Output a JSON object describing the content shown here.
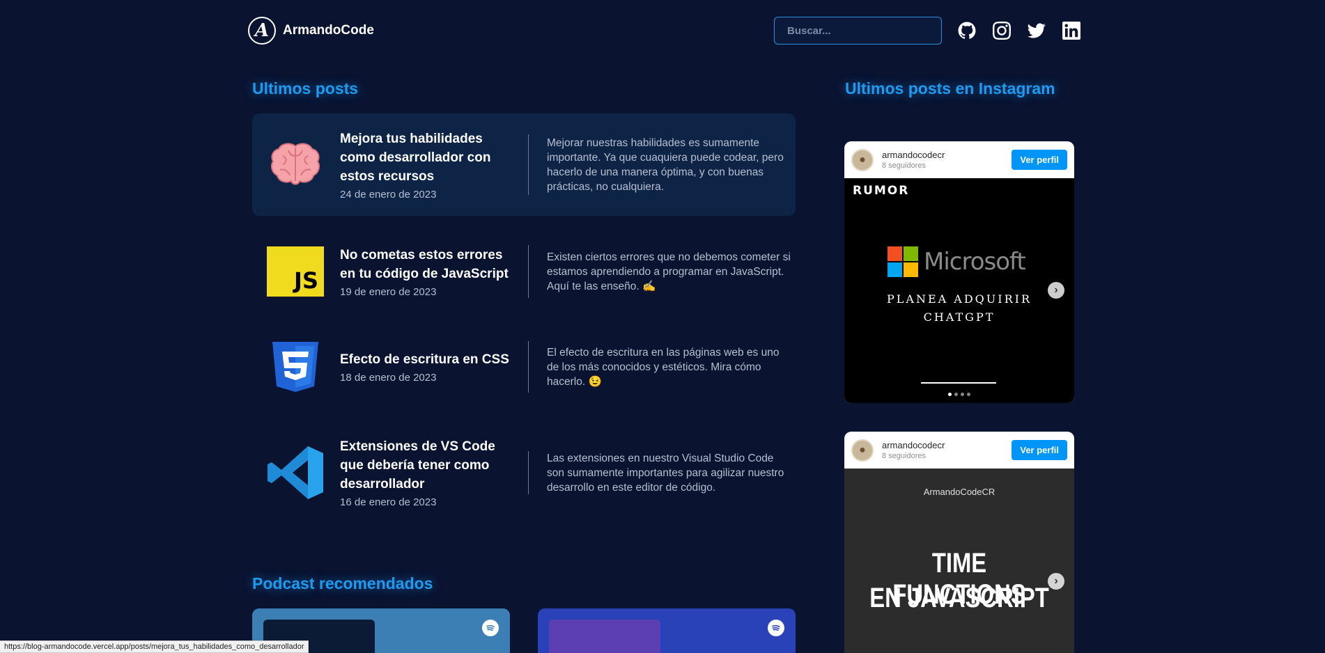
{
  "header": {
    "brand_initial": "A",
    "brand_name": "ArmandoCode",
    "search_placeholder": "Buscar...",
    "social_icons": [
      "github-icon",
      "instagram-icon",
      "twitter-icon",
      "linkedin-icon"
    ]
  },
  "sections": {
    "latest_posts": "Ultimos posts",
    "instagram": "Ultimos posts en Instagram",
    "podcasts": "Podcast recomendados"
  },
  "posts": [
    {
      "icon": "brain-icon",
      "title": "Mejora tus habilidades como desarrollador con estos recursos",
      "date": "24 de enero de 2023",
      "description": "Mejorar nuestras habilidades es sumamente importante. Ya que cuaquiera puede codear, pero hacerlo de una manera óptima, y con buenas prácticas, no cualquiera."
    },
    {
      "icon": "javascript-icon",
      "icon_text": "JS",
      "title": "No cometas estos errores en tu código de JavaScript",
      "date": "19 de enero de 2023",
      "description": "Existen ciertos errores que no debemos cometer si estamos aprendiendo a programar en JavaScript. Aquí te las enseño. ✍️"
    },
    {
      "icon": "css3-icon",
      "title": "Efecto de escritura en CSS",
      "date": "18 de enero de 2023",
      "description": "El efecto de escritura en las páginas web es uno de los más conocidos y estéticos. Mira cómo hacerlo. 😉"
    },
    {
      "icon": "vscode-icon",
      "title": "Extensiones de VS Code que debería tener como desarrollador",
      "date": "16 de enero de 2023",
      "description": "Las extensiones en nuestro Visual Studio Code son sumamente importantes para agilizar nuestro desarrollo en este editor de código."
    }
  ],
  "instagram_posts": [
    {
      "username": "armandocodecr",
      "followers": "8 seguidores",
      "button": "Ver perfil",
      "overlay_tag": "RUMOR",
      "brand": "Microsoft",
      "headline_line1": "PLANEA ADQUIRIR",
      "headline_line2": "CHATGPT"
    },
    {
      "username": "armandocodecr",
      "followers": "8 seguidores",
      "button": "Ver perfil",
      "caption_top": "ArmandoCodeCR",
      "headline_line1": "TIME FUNCTIONS",
      "headline_line2": "EN JAVASCRIPT"
    }
  ],
  "status_url": "https://blog-armandocode.vercel.app/posts/mejora_tus_habilidades_como_desarrollador",
  "colors": {
    "background": "#0a1330",
    "accent": "#1e9bf0",
    "active_post": "#0e2447",
    "instagram_button": "#0095f6"
  }
}
